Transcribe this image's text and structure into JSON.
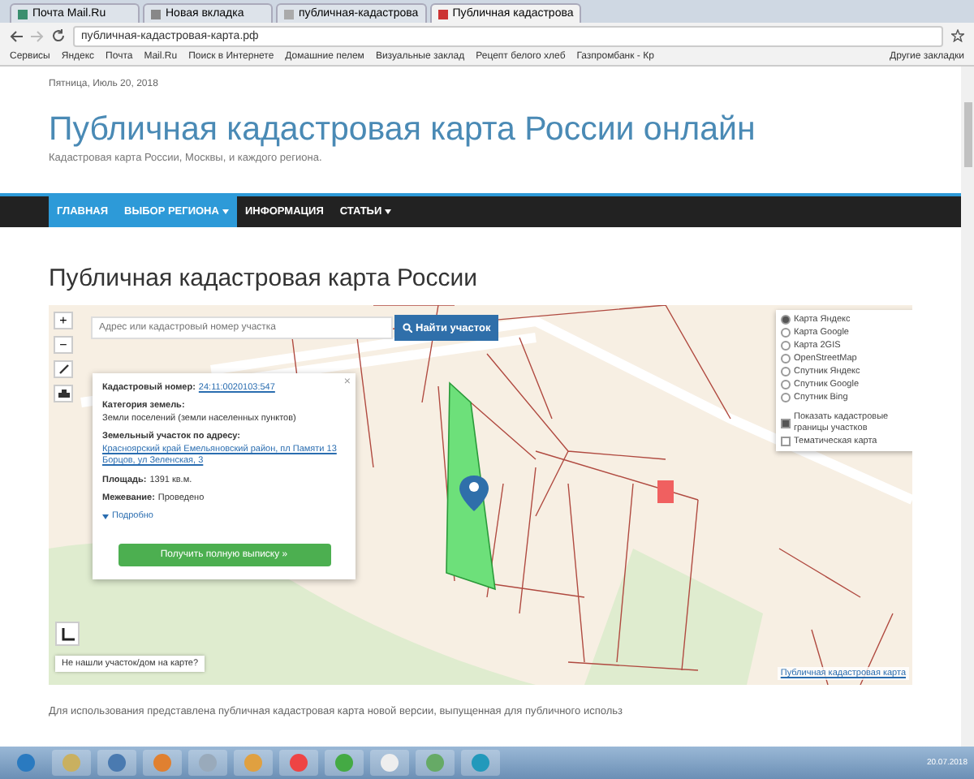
{
  "browser": {
    "tabs": [
      {
        "label": "Почта Mail.Ru",
        "selected": false
      },
      {
        "label": "Новая вкладка",
        "selected": false
      },
      {
        "label": "публичная-кадастрова",
        "selected": false
      },
      {
        "label": "Публичная кадастрова",
        "selected": true
      }
    ],
    "address": "публичная-кадастровая-карта.рф",
    "bookmarks": [
      "Сервисы",
      "Яндекс",
      "Почта",
      "Mail.Ru",
      "Поиск в Интернете",
      "Домашние пелем",
      "Визуальные заклад",
      "Рецепт белого хлеб",
      "Газпромбанк - Кр"
    ],
    "other_bookmarks": "Другие закладки"
  },
  "page": {
    "date": "Пятница, Июль 20, 2018",
    "site_title": "Публичная кадастровая карта России онлайн",
    "tagline": "Кадастровая карта России, Москвы, и каждого региона.",
    "nav": [
      {
        "label": "ГЛАВНАЯ",
        "selected": true,
        "dropdown": false
      },
      {
        "label": "ВЫБОР РЕГИОНА",
        "selected": true,
        "dropdown": true
      },
      {
        "label": "ИНФОРМАЦИЯ",
        "selected": false,
        "dropdown": false
      },
      {
        "label": "СТАТЬИ",
        "selected": false,
        "dropdown": true
      }
    ],
    "heading": "Публичная кадастровая карта России",
    "map": {
      "search_placeholder": "Адрес или кадастровый номер участка",
      "search_button": "Найти участок",
      "zoom_in": "+",
      "zoom_out": "−",
      "popup": {
        "rows": [
          {
            "label": "Кадастровый номер:",
            "value": "24:11:0020103:547",
            "link": true
          },
          {
            "label": "Категория земель:",
            "value": "Земли поселений (земли населенных пунктов)",
            "link": false
          },
          {
            "label": "Земельный участок по адресу:",
            "value": "Красноярский край Емельяновский район, пл Памяти 13 Борцов, ул Зеленская, 3",
            "link": true
          },
          {
            "label": "Площадь:",
            "value": "1391 кв.м.",
            "link": false
          },
          {
            "label": "Межевание:",
            "value": "Проведено",
            "link": false
          }
        ],
        "details": "Подробно",
        "button": "Получить полную выписку »",
        "close": "×"
      },
      "layers": [
        {
          "label": "Карта Яндекс",
          "selected": true
        },
        {
          "label": "Карта Google",
          "selected": false
        },
        {
          "label": "Карта 2GIS",
          "selected": false
        },
        {
          "label": "OpenStreetMap",
          "selected": false
        },
        {
          "label": "Спутник Яндекс",
          "selected": false
        },
        {
          "label": "Спутник Google",
          "selected": false
        },
        {
          "label": "Спутник Bing",
          "selected": false
        }
      ],
      "overlays": [
        {
          "label": "Показать кадастровые границы участков",
          "checked": true
        },
        {
          "label": "Тематическая карта",
          "checked": false
        }
      ],
      "not_found": "Не нашли участок/дом на карте?",
      "attribution": "Публичная кадастровая карта"
    },
    "intro": "Для использования представлена публичная кадастровая карта новой версии, выпущенная для публичного использ"
  },
  "taskbar": {
    "clock": "20.07.2018"
  }
}
